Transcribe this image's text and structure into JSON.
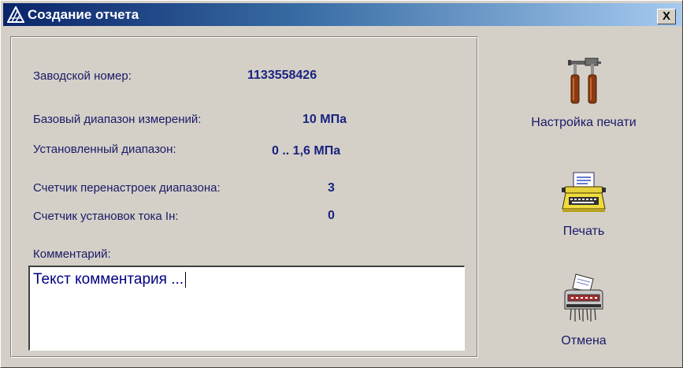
{
  "window": {
    "title": "Создание отчета",
    "close_label": "X"
  },
  "fields": {
    "serial_label": "Заводской номер:",
    "serial_value": "1133558426",
    "base_range_label": "Базовый диапазон измерений:",
    "base_range_value": "10 МПа",
    "set_range_label": "Установленный диапазон:",
    "set_range_value": "0 .. 1,6 МПа",
    "reconfig_label": "Счетчик перенастроек диапазона:",
    "reconfig_value": "3",
    "current_label": "Счетчик установок тока Iн:",
    "current_value": "0"
  },
  "comment": {
    "label": "Комментарий:",
    "value": "Текст комментария ..."
  },
  "actions": {
    "print_setup": {
      "label": "Настройка печати",
      "icon": "tools-icon"
    },
    "print": {
      "label": "Печать",
      "icon": "typewriter-icon"
    },
    "cancel": {
      "label": "Отмена",
      "icon": "shredder-icon"
    }
  },
  "colors": {
    "title_start": "#0a246a",
    "title_end": "#a6caf0",
    "text": "#1a237e",
    "face": "#d4d0c8"
  }
}
